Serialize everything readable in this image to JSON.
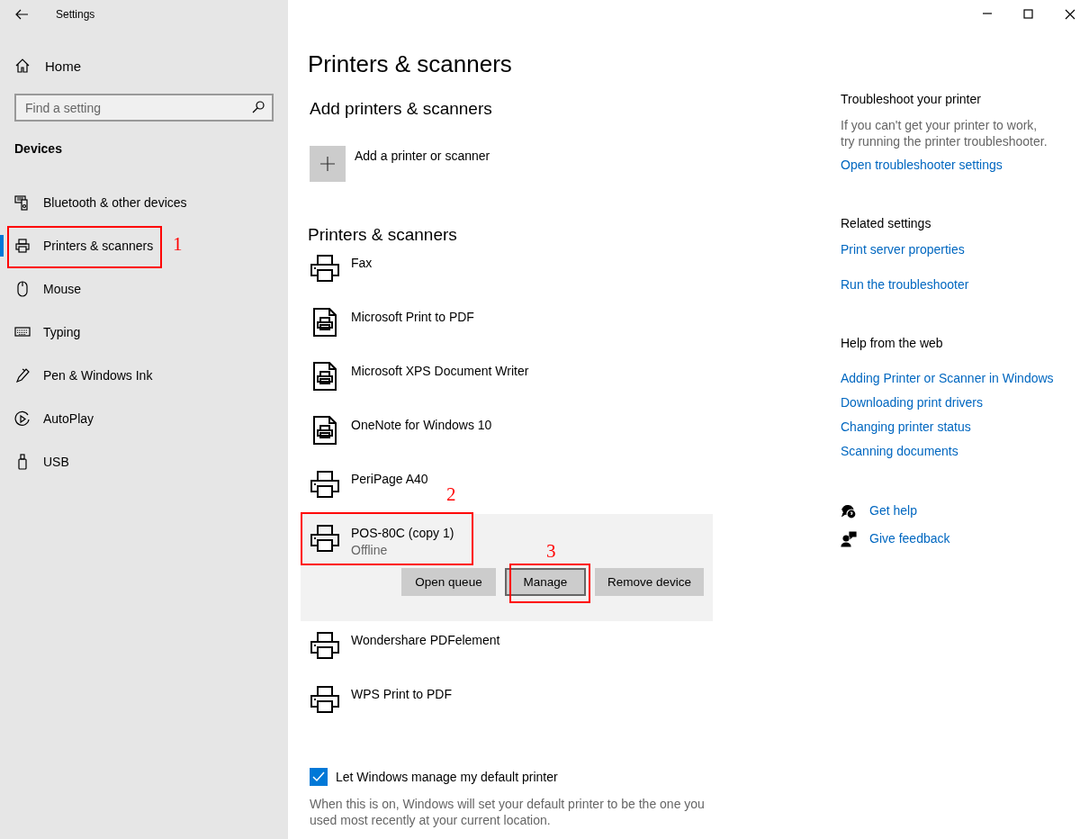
{
  "window": {
    "title": "Settings"
  },
  "sidebar": {
    "home": "Home",
    "search": {
      "placeholder": "Find a setting"
    },
    "section": "Devices",
    "items": [
      {
        "label": "Bluetooth & other devices",
        "kind": "bluetooth",
        "selected": false
      },
      {
        "label": "Printers & scanners",
        "kind": "printer",
        "selected": true,
        "annotation": "1"
      },
      {
        "label": "Mouse",
        "kind": "mouse",
        "selected": false
      },
      {
        "label": "Typing",
        "kind": "keyboard",
        "selected": false
      },
      {
        "label": "Pen & Windows Ink",
        "kind": "pen",
        "selected": false
      },
      {
        "label": "AutoPlay",
        "kind": "autoplay",
        "selected": false
      },
      {
        "label": "USB",
        "kind": "usb",
        "selected": false
      }
    ]
  },
  "page": {
    "title": "Printers & scanners",
    "add_section": {
      "heading": "Add printers & scanners",
      "button": "Add a printer or scanner"
    },
    "list_heading": "Printers & scanners",
    "printers": [
      {
        "name": "Fax",
        "kind": "printer",
        "selected": false
      },
      {
        "name": "Microsoft Print to PDF",
        "kind": "document",
        "selected": false
      },
      {
        "name": "Microsoft XPS Document Writer",
        "kind": "document",
        "selected": false
      },
      {
        "name": "OneNote for Windows 10",
        "kind": "document",
        "selected": false
      },
      {
        "name": "PeriPage A40",
        "kind": "printer",
        "selected": false
      },
      {
        "name": "POS-80C (copy 1)",
        "kind": "printer",
        "status": "Offline",
        "selected": true,
        "annotation": "2",
        "actions": [
          {
            "label": "Open queue",
            "focused": false
          },
          {
            "label": "Manage",
            "focused": true,
            "annotation": "3"
          },
          {
            "label": "Remove device",
            "focused": false
          }
        ]
      },
      {
        "name": "Wondershare PDFelement",
        "kind": "printer",
        "selected": false
      },
      {
        "name": "WPS Print to PDF",
        "kind": "printer",
        "selected": false
      }
    ],
    "default_printer": {
      "label": "Let Windows manage my default printer",
      "checked": true,
      "description": "When this is on, Windows will set your default printer to be the one you used most recently at your current location."
    }
  },
  "side_panel": [
    {
      "heading": "Troubleshoot your printer",
      "description": "If you can't get your printer to work, try running the printer troubleshooter.",
      "links": [
        "Open troubleshooter settings"
      ]
    },
    {
      "heading": "Related settings",
      "links": [
        "Print server properties",
        "Run the troubleshooter"
      ]
    },
    {
      "heading": "Help from the web",
      "links": [
        "Adding Printer or Scanner in Windows",
        "Downloading print drivers",
        "Changing printer status",
        "Scanning documents"
      ]
    }
  ],
  "help_links": [
    {
      "label": "Get help",
      "kind": "help"
    },
    {
      "label": "Give feedback",
      "kind": "feedback"
    }
  ]
}
